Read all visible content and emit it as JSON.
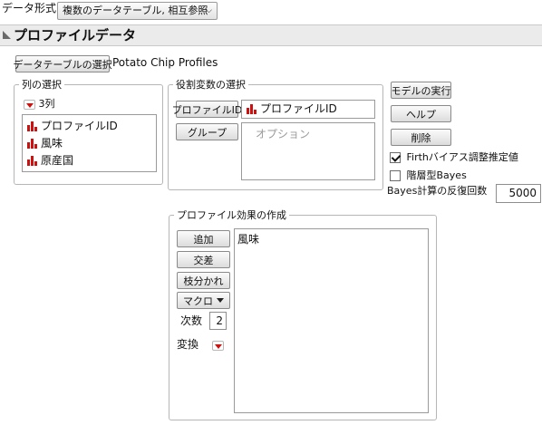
{
  "top": {
    "data_format_label": "データ形式",
    "data_format_value": "複数のデータテーブル, 相互参照"
  },
  "section": {
    "title": "プロファイルデータ"
  },
  "datatable": {
    "select_button": "データテーブルの選択",
    "table_name": "Potato Chip Profiles"
  },
  "column_select": {
    "legend": "列の選択",
    "count_label": "3列",
    "items": [
      "プロファイルID",
      "風味",
      "原産国"
    ]
  },
  "role_select": {
    "legend": "役割変数の選択",
    "profile_id_button": "プロファイルID",
    "profile_id_value": "プロファイルID",
    "group_button": "グループ",
    "group_placeholder": "オプション"
  },
  "actions": {
    "run_model": "モデルの実行",
    "help": "ヘルプ",
    "remove": "削除",
    "firth_label": "Firthバイアス調整推定値",
    "firth_checked": true,
    "hierarchical_bayes_label": "階層型Bayes",
    "hierarchical_bayes_checked": false,
    "bayes_iterations_label": "Bayes計算の反復回数",
    "bayes_iterations_value": "5000"
  },
  "effects": {
    "legend": "プロファイル効果の作成",
    "add_button": "追加",
    "cross_button": "交差",
    "nest_button": "枝分かれ",
    "macro_button": "マクロ",
    "degree_label": "次数",
    "degree_value": "2",
    "transform_label": "変換",
    "effect_items": [
      "風味"
    ]
  },
  "colors": {
    "accent_red": "#cc1111",
    "section_header_bg": "#e9e9e9",
    "border_gray": "#b6b6b6"
  }
}
